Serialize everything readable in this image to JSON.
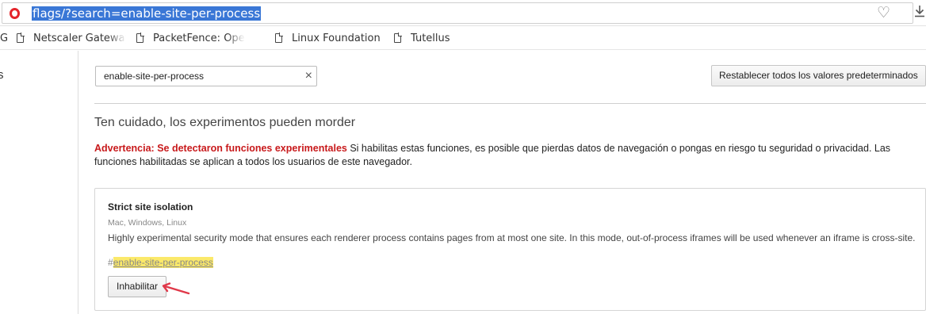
{
  "address_bar": {
    "url": "flags/?search=enable-site-per-process"
  },
  "bookmarks": [
    {
      "label": "G",
      "has_icon": false
    },
    {
      "label": "Netscaler Gateway",
      "has_icon": true
    },
    {
      "label": "PacketFence: Ope",
      "has_icon": true
    },
    {
      "label": "Linux Foundation",
      "has_icon": true
    },
    {
      "label": "Tutellus",
      "has_icon": true
    }
  ],
  "sidebar": {
    "fragment": "s"
  },
  "search": {
    "value": "enable-site-per-process",
    "clear_glyph": "×"
  },
  "reset_button": {
    "label": "Restablecer todos los valores predeterminados"
  },
  "warning": {
    "title": "Ten cuidado, los experimentos pueden morder",
    "strong": "Advertencia: Se detectaron funciones experimentales",
    "body": " Si habilitas estas funciones, es posible que pierdas datos de navegación o pongas en riesgo tu seguridad o privacidad. Las funciones habilitadas se aplican a todos los usuarios de este navegador."
  },
  "experiment": {
    "title": "Strict site isolation",
    "platforms": "Mac, Windows, Linux",
    "description": "Highly experimental security mode that ensures each renderer process contains pages from at most one site. In this mode, out-of-process iframes will be used whenever an iframe is cross-site.",
    "link_hash": "#",
    "link_name": "enable-site-per-process",
    "button_label": "Inhabilitar"
  },
  "icons": {
    "browser": "opera-logo-icon",
    "bookmark": "heart-icon",
    "download": "download-icon",
    "page": "page-icon",
    "clear": "clear-icon",
    "annotation": "red-arrow-annotation"
  },
  "colors": {
    "url_highlight": "#3a77d6",
    "warning_red": "#c8191b",
    "link_highlight": "#fbe96a",
    "annotation_arrow": "#e0394a"
  }
}
